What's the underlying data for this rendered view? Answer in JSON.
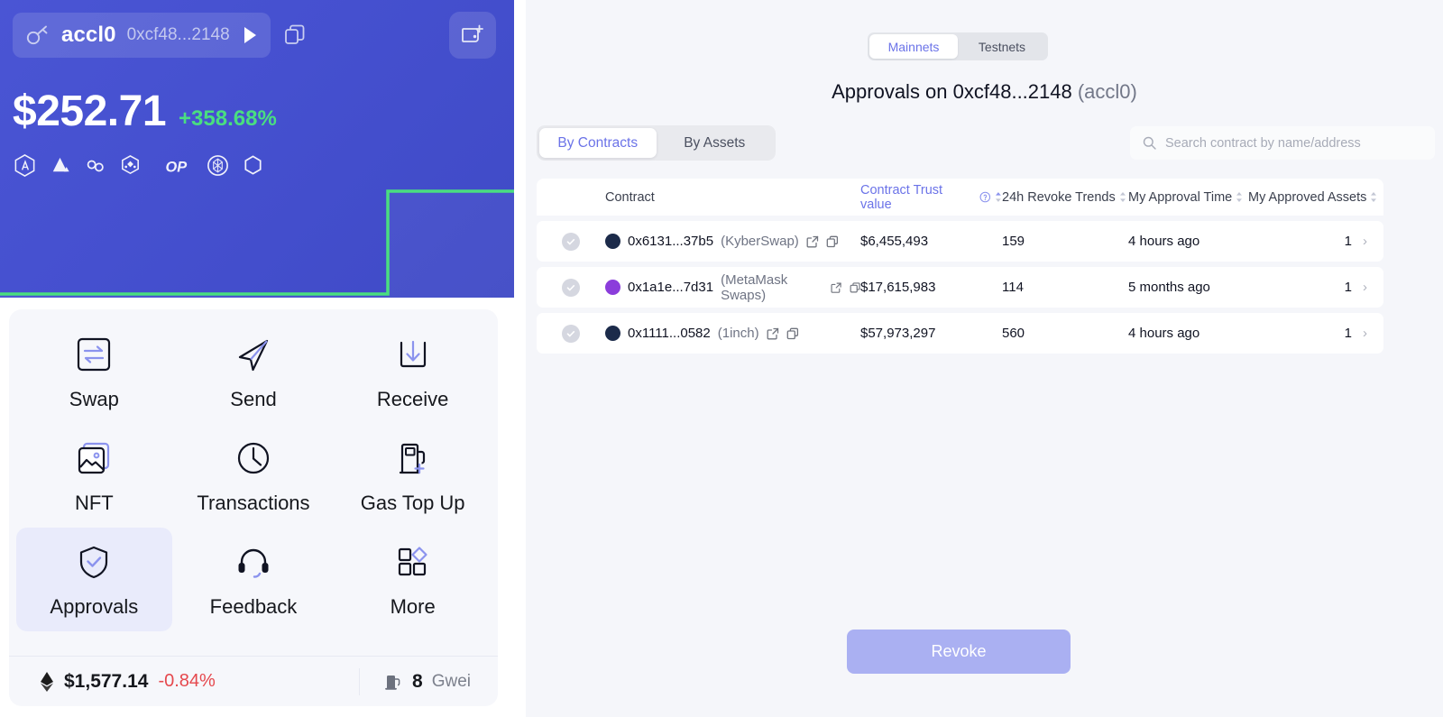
{
  "wallet": {
    "account_name": "accl0",
    "account_address": "0xcf48...2148",
    "key_icon": "key-icon",
    "expand_icon": "play-triangle-icon",
    "copy_icon": "copy-icon",
    "add_wallet_icon": "add-wallet-icon",
    "balance": "$252.71",
    "balance_change": "+358.68%",
    "balance_change_color": "#4ade80",
    "chains": [
      {
        "name": "arbitrum-chain-icon"
      },
      {
        "name": "avalanche-chain-icon"
      },
      {
        "name": "chainlink-chain-icon"
      },
      {
        "name": "bnb-chain-icon"
      },
      {
        "name": "optimism-chain-icon"
      },
      {
        "name": "fantom-chain-icon"
      },
      {
        "name": "polygon-chain-icon"
      }
    ],
    "sparkline_color": "#4ade80"
  },
  "actions": [
    {
      "label": "Swap",
      "icon": "swap-icon",
      "active": false
    },
    {
      "label": "Send",
      "icon": "send-icon",
      "active": false
    },
    {
      "label": "Receive",
      "icon": "receive-icon",
      "active": false
    },
    {
      "label": "NFT",
      "icon": "nft-icon",
      "active": false
    },
    {
      "label": "Transactions",
      "icon": "clock-icon",
      "active": false
    },
    {
      "label": "Gas Top Up",
      "icon": "gas-pump-icon",
      "active": false
    },
    {
      "label": "Approvals",
      "icon": "shield-check-icon",
      "active": true
    },
    {
      "label": "Feedback",
      "icon": "headset-icon",
      "active": false
    },
    {
      "label": "More",
      "icon": "grid-more-icon",
      "active": false
    }
  ],
  "gasbar": {
    "eth_icon": "ethereum-icon",
    "eth_price": "$1,577.14",
    "eth_change": "-0.84%",
    "eth_change_color": "#e5484d",
    "gas_icon": "gas-pump-icon",
    "gas_value": "8",
    "gas_unit": "Gwei"
  },
  "page": {
    "network_tabs": [
      {
        "label": "Mainnets",
        "selected": true
      },
      {
        "label": "Testnets",
        "selected": false
      }
    ],
    "title_main": "Approvals on 0xcf48...2148",
    "title_sub": "(accl0)",
    "mode_tabs": [
      {
        "label": "By Contracts",
        "selected": true
      },
      {
        "label": "By Assets",
        "selected": false
      }
    ],
    "search": {
      "icon": "search-icon",
      "placeholder": "Search contract by name/address",
      "value": ""
    },
    "columns": [
      {
        "label": "Contract",
        "sortable": false,
        "accent": false
      },
      {
        "label": "Contract Trust value",
        "sortable": true,
        "accent": true,
        "info_icon": "info-circle-icon"
      },
      {
        "label": "24h Revoke Trends",
        "sortable": true,
        "accent": false
      },
      {
        "label": "My Approval Time",
        "sortable": true,
        "accent": false
      },
      {
        "label": "My Approved Assets",
        "sortable": true,
        "accent": false
      }
    ],
    "rows": [
      {
        "checkbox_icon": "check-circle-icon",
        "checked": false,
        "token_icon": "kyberswap-token-icon",
        "token_color": "#1c2b4a",
        "address": "0x6131...37b5",
        "project": "(KyberSwap)",
        "external_icon": "external-link-icon",
        "copy_icon": "copy-icon",
        "trust_value": "$6,455,493",
        "revoke_trend": "159",
        "approval_time": "4 hours ago",
        "approved_assets": "1",
        "chevron_icon": "chevron-right-icon"
      },
      {
        "checkbox_icon": "check-circle-icon",
        "checked": false,
        "token_icon": "metamask-token-icon",
        "token_color": "#8b3ddb",
        "address": "0x1a1e...7d31",
        "project": "(MetaMask Swaps)",
        "external_icon": "external-link-icon",
        "copy_icon": "copy-icon",
        "trust_value": "$17,615,983",
        "revoke_trend": "114",
        "approval_time": "5 months ago",
        "approved_assets": "1",
        "chevron_icon": "chevron-right-icon"
      },
      {
        "checkbox_icon": "check-circle-icon",
        "checked": false,
        "token_icon": "1inch-token-icon",
        "token_color": "#1c2b4a",
        "address": "0x1111...0582",
        "project": "(1inch)",
        "external_icon": "external-link-icon",
        "copy_icon": "copy-icon",
        "trust_value": "$57,973,297",
        "revoke_trend": "560",
        "approval_time": "4 hours ago",
        "approved_assets": "1",
        "chevron_icon": "chevron-right-icon"
      }
    ],
    "revoke_label": "Revoke",
    "revoke_color": "#aab0f2"
  },
  "colors": {
    "brand_blue": "#4a55d4",
    "accent_purple": "#6b73e8",
    "page_bg": "#f5f6fa"
  }
}
